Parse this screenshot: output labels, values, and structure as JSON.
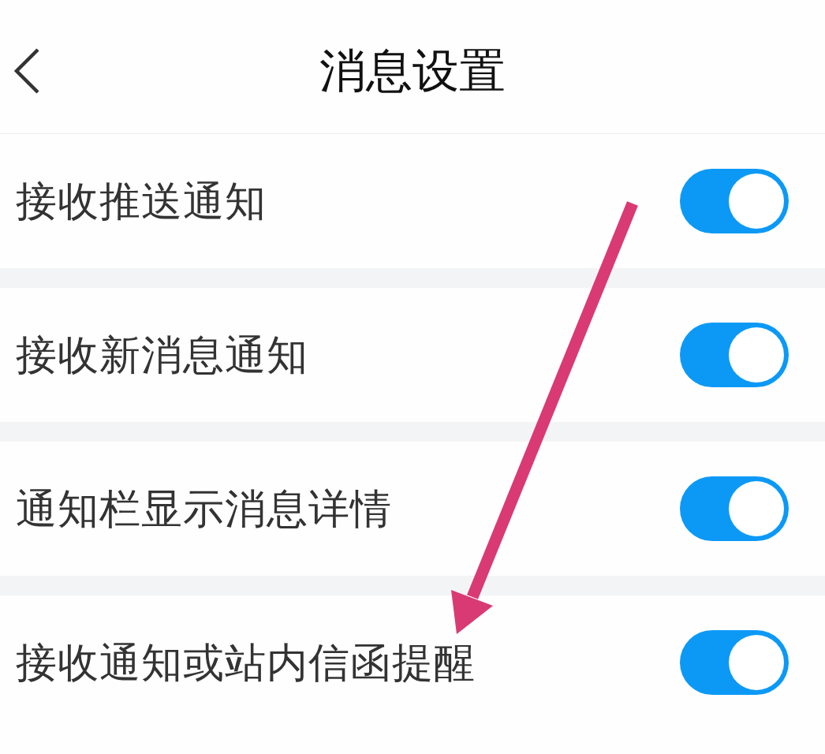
{
  "header": {
    "title": "消息设置"
  },
  "settings": [
    {
      "label": "接收推送通知",
      "on": true
    },
    {
      "label": "接收新消息通知",
      "on": true
    },
    {
      "label": "通知栏显示消息详情",
      "on": true
    },
    {
      "label": "接收通知或站内信函提醒",
      "on": true
    }
  ],
  "annotations": [
    {
      "kind": "arrow"
    }
  ]
}
